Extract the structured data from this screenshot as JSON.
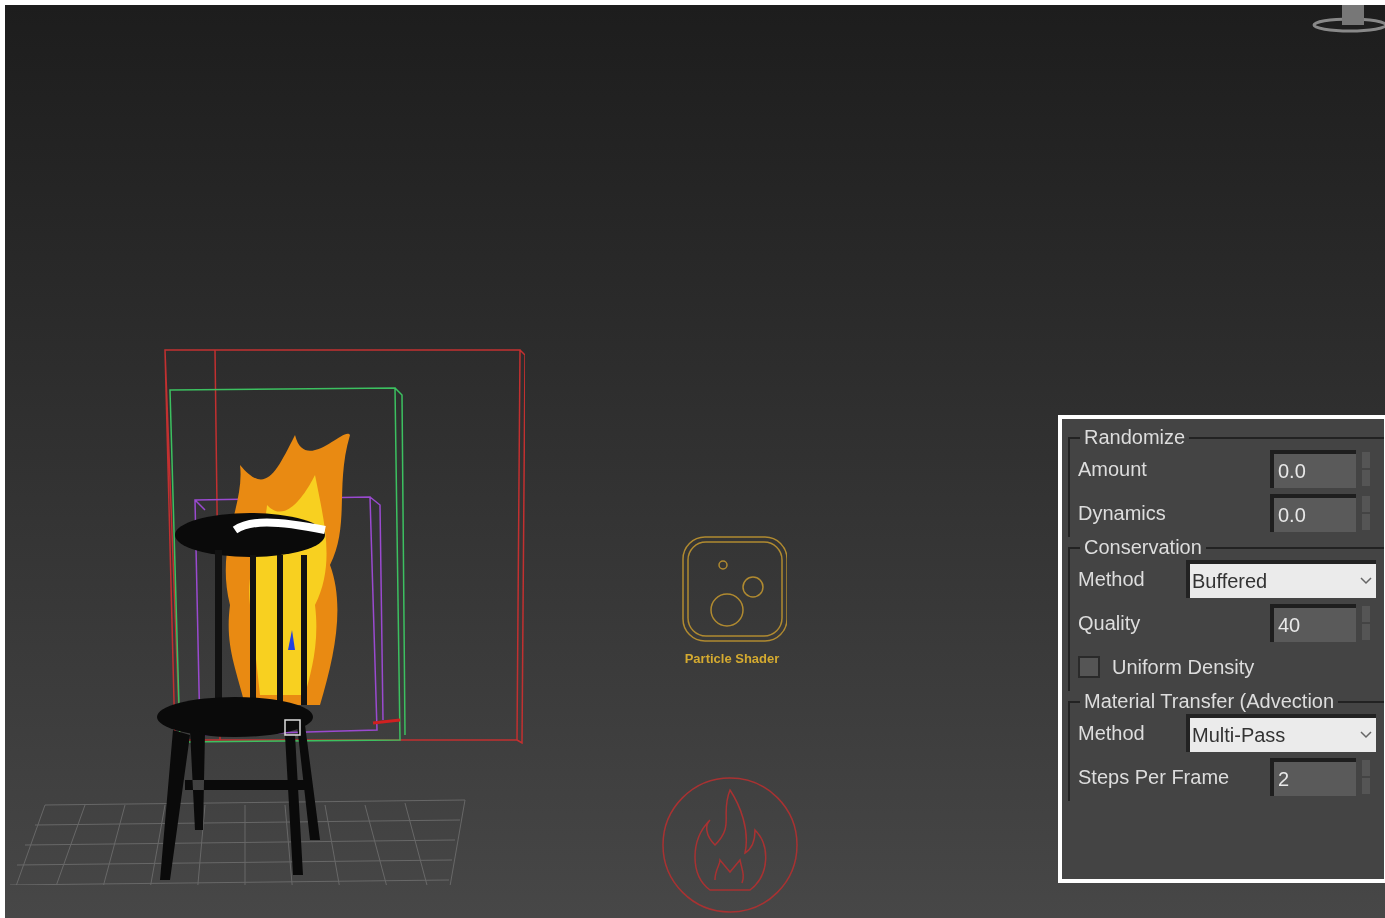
{
  "viewport": {
    "helpers": [
      {
        "kind": "particle",
        "label": "Particle Shader"
      },
      {
        "kind": "fire"
      }
    ]
  },
  "panel": {
    "groups": [
      {
        "title": "Randomize",
        "rows": [
          {
            "kind": "spinner",
            "label": "Amount",
            "value": "0.0"
          },
          {
            "kind": "spinner",
            "label": "Dynamics",
            "value": "0.0"
          }
        ]
      },
      {
        "title": "Conservation",
        "rows": [
          {
            "kind": "dropdown",
            "label": "Method",
            "value": "Buffered"
          },
          {
            "kind": "spinner",
            "label": "Quality",
            "value": "40"
          },
          {
            "kind": "checkbox",
            "label": "Uniform Density",
            "checked": false
          }
        ]
      },
      {
        "title": "Material Transfer (Advection",
        "rows": [
          {
            "kind": "dropdown",
            "label": "Method",
            "value": "Multi-Pass"
          },
          {
            "kind": "spinner",
            "label": "Steps Per Frame",
            "value": "2"
          }
        ]
      }
    ]
  }
}
